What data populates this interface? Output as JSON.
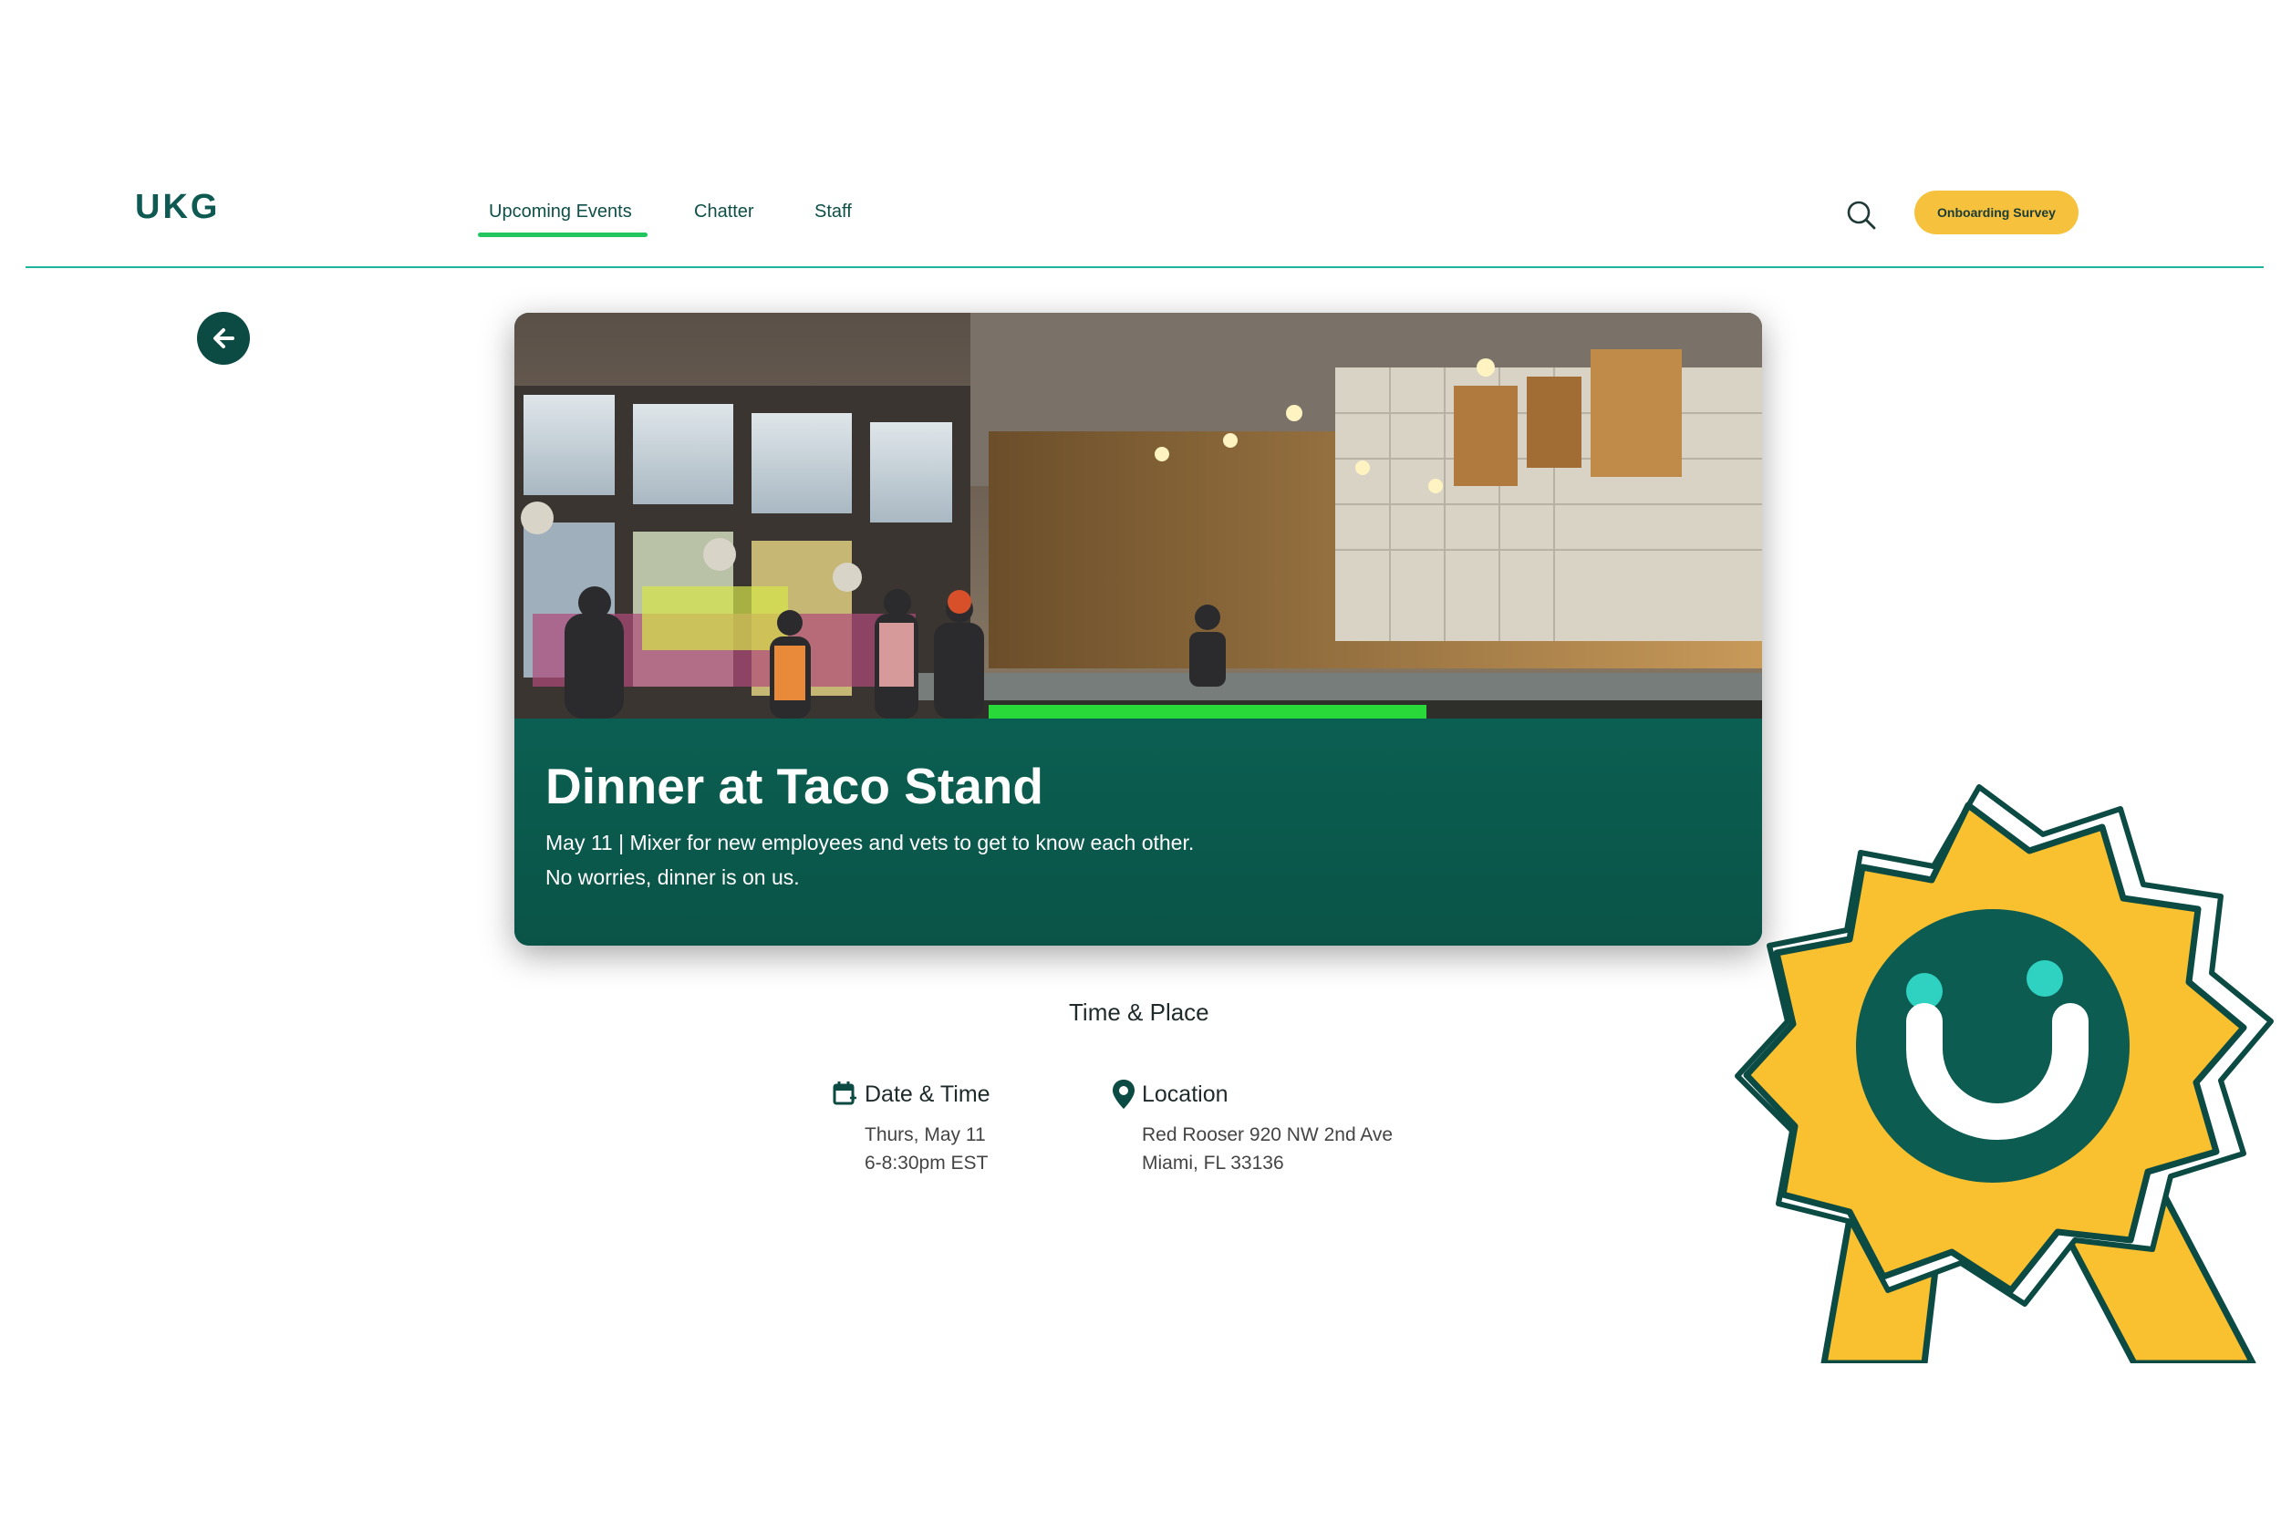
{
  "header": {
    "logo_text": "UKG",
    "nav": [
      {
        "label": "Upcoming Events",
        "active": true
      },
      {
        "label": "Chatter",
        "active": false
      },
      {
        "label": "Staff",
        "active": false
      }
    ],
    "search_icon": "search-icon",
    "survey_button": "Onboarding Survey"
  },
  "back_icon": "arrow-left-icon",
  "event": {
    "title": "Dinner at Taco Stand",
    "description": "May 11 | Mixer for new employees and vets to get to know each other. No worries, dinner is on us."
  },
  "time_place": {
    "heading": "Time & Place",
    "date_time": {
      "icon": "calendar-icon",
      "label": "Date & Time",
      "line1": "Thurs, May 11",
      "line2": "6-8:30pm EST"
    },
    "location": {
      "icon": "map-pin-icon",
      "label": "Location",
      "line1": "Red Rooser 920 NW 2nd Ave",
      "line2": "Miami, FL 33136"
    }
  },
  "colors": {
    "brand_dark": "#0c4a44",
    "accent_green": "#22c55e",
    "teal_line": "#1fb59a",
    "survey_yellow": "#f6c23e",
    "card_band": "#0b5f52",
    "badge_yellow": "#f9c02f"
  }
}
